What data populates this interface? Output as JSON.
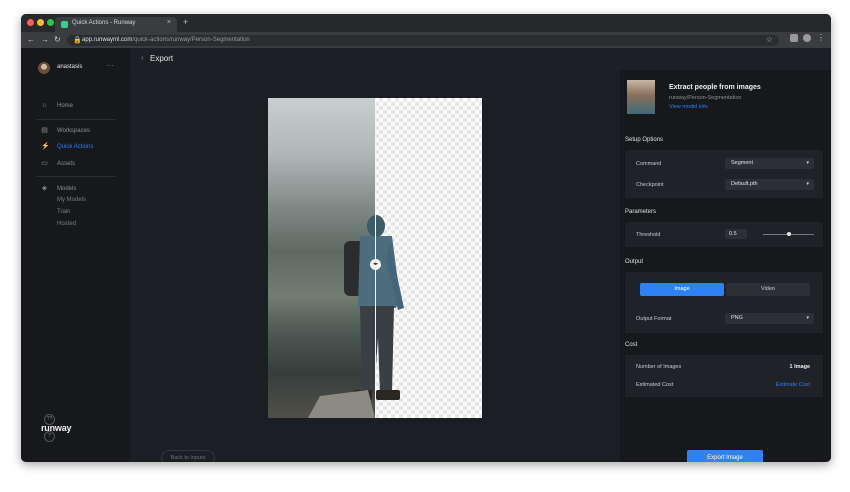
{
  "browser": {
    "tab_title": "Quick Actions - Runway",
    "tab_close": "×",
    "new_tab": "+",
    "url_host": "app.runwayml.com",
    "url_path": "/quick-actions/runway/Person-Segmentation"
  },
  "sidebar": {
    "username": "anastasis",
    "user_menu": "···",
    "items": [
      {
        "label": "Home",
        "icon": "home-icon"
      },
      {
        "label": "Workspaces",
        "icon": "workspaces-icon"
      },
      {
        "label": "Quick Actions",
        "icon": "lightning-icon",
        "active": true
      },
      {
        "label": "Assets",
        "icon": "assets-icon"
      },
      {
        "label": "Models",
        "icon": "models-icon"
      }
    ],
    "sub_items": [
      "My Models",
      "Train",
      "Hosted"
    ],
    "help_circles": [
      "??",
      "?"
    ],
    "brand": "runway"
  },
  "header": {
    "back_icon": "‹",
    "title": "Export"
  },
  "canvas": {
    "back_button": "Back to Inputs",
    "split_handle": "◂▸"
  },
  "panel": {
    "model_title": "Extract people from images",
    "model_path": "runway/Person-Segmentation",
    "model_link": "View model info",
    "setup_title": "Setup Options",
    "command_label": "Command",
    "command_value": "Segment",
    "checkpoint_label": "Checkpoint",
    "checkpoint_value": "Default.pth",
    "parameters_title": "Parameters",
    "threshold_label": "Threshold",
    "threshold_value": "0.5",
    "output_title": "Output",
    "output_tabs": [
      "Image",
      "Video"
    ],
    "output_format_label": "Output Format",
    "output_format_value": "PNG",
    "cost_title": "Cost",
    "num_images_label": "Number of Images",
    "num_images_value": "1 Image",
    "estimated_cost_label": "Estimated Cost",
    "estimated_cost_link": "Estimate Cost",
    "export_button": "Export Image",
    "caret": "▾"
  },
  "colors": {
    "accent": "#2f82f5",
    "sidebar_bg": "#16181b",
    "canvas_bg": "#1b1e22"
  }
}
